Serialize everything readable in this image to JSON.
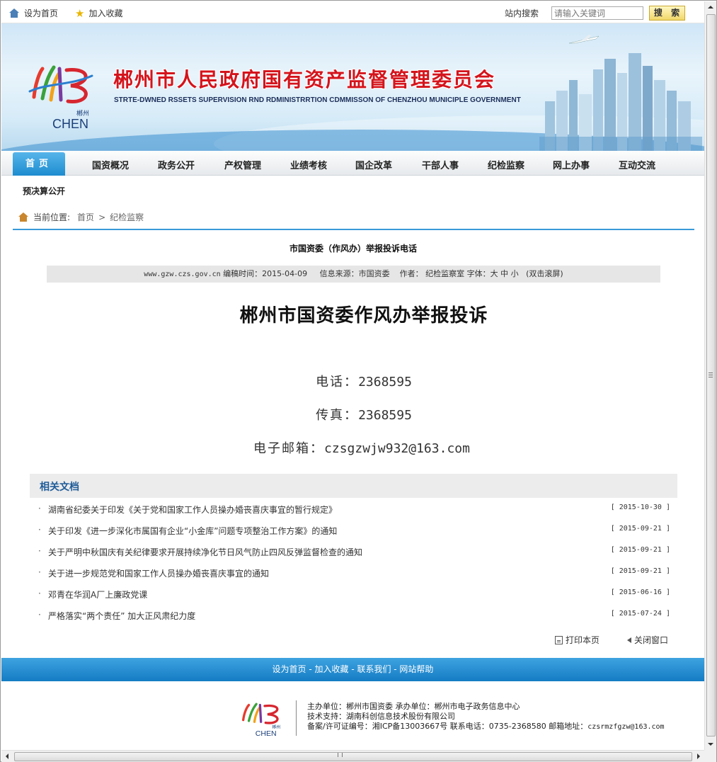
{
  "topbar": {
    "set_home": "设为首页",
    "add_fav": "加入收藏",
    "search_label": "站内搜索",
    "search_placeholder": "请输入关键词",
    "search_button": "搜 索"
  },
  "banner": {
    "logo_text": "CHEN",
    "logo_small": "郴州",
    "title": "郴州市人民政府国有资产监督管理委员会",
    "subtitle": "STRTE-DWNED RSSETS SUPERVISION RND RDMINISTRRTION CDMMISSON OF CHENZHOU MUNICIPLE GOVERNMENT"
  },
  "nav": {
    "home": "首页",
    "items": [
      "国资概况",
      "政务公开",
      "产权管理",
      "业绩考核",
      "国企改革",
      "干部人事",
      "纪检监察",
      "网上办事",
      "互动交流"
    ],
    "sub": "预决算公开"
  },
  "breadcrumb": {
    "label": "当前位置:",
    "home": "首页",
    "sep": ">",
    "current": "纪检监察"
  },
  "article": {
    "title": "市国资委（作风办）举报投诉电话",
    "meta_site": "www.gzw.czs.gov.cn",
    "meta_time": "编稿时间：2015-04-09",
    "meta_source": "信息来源：市国资委",
    "meta_author": "作者： 纪检监察室",
    "meta_font": "字体：大 中 小",
    "meta_scroll": "(双击滚屏)",
    "headline": "郴州市国资委作风办举报投诉",
    "phone_label": "电话：",
    "phone": "2368595",
    "fax_label": "传真：",
    "fax": "2368595",
    "email_label": "电子邮箱：",
    "email": "czsgzwjw932@163.com"
  },
  "related": {
    "heading": "相关文档",
    "items": [
      {
        "title": "湖南省纪委关于印发《关于党和国家工作人员操办婚丧喜庆事宜的暂行规定》",
        "date": "[ 2015-10-30 ]"
      },
      {
        "title": "关于印发《进一步深化市属国有企业“小金库”问题专项整治工作方案》的通知",
        "date": "[ 2015-09-21 ]"
      },
      {
        "title": "关于严明中秋国庆有关纪律要求开展持续净化节日风气防止四风反弹监督检查的通知",
        "date": "[ 2015-09-21 ]"
      },
      {
        "title": "关于进一步规范党和国家工作人员操办婚丧喜庆事宜的通知",
        "date": "[ 2015-09-21 ]"
      },
      {
        "title": "邓青在华润A厂上廉政党课",
        "date": "[ 2015-06-16 ]"
      },
      {
        "title": "严格落实“两个责任” 加大正风肃纪力度",
        "date": "[ 2015-07-24 ]"
      }
    ]
  },
  "actions": {
    "print": "打印本页",
    "close": "关闭窗口"
  },
  "footer": {
    "links": "设为首页 - 加入收藏 - 联系我们 - 网站帮助",
    "line1": "主办单位：郴州市国资委   承办单位：郴州市电子政务信息中心",
    "line2": "技术支持：湖南科创信息技术股份有限公司",
    "line3_a": "备案/许可证编号：湘ICP备13003667号 联系电话：0735-2368580 邮箱地址：",
    "line3_b": "czsrmzfgzw@163.com"
  },
  "colors": {
    "accent": "#1d8ccf",
    "title_red": "#d4141c",
    "footer_bar": "#147cc4"
  }
}
